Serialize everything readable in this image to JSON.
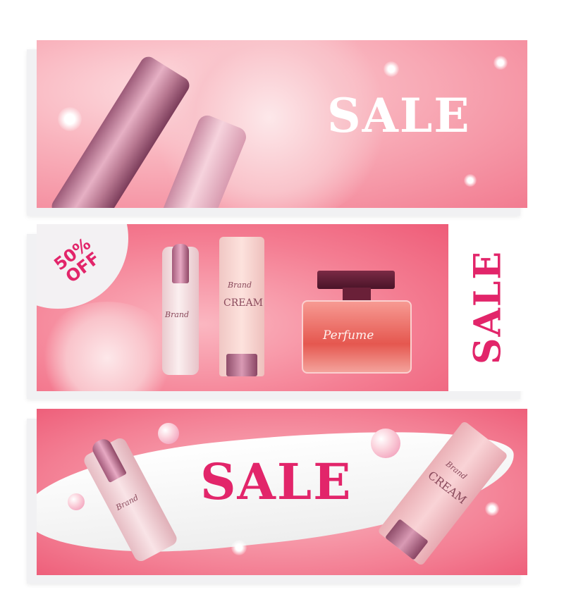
{
  "banner1": {
    "headline": "SALE"
  },
  "banner2": {
    "badge": "50% OFF",
    "headline": "SALE",
    "serum_label": "Brand",
    "tube_brand": "Brand",
    "tube_label": "CREAM",
    "perfume_label": "Perfume"
  },
  "banner3": {
    "headline": "SALE",
    "serum_label": "Brand",
    "tube_brand": "Brand",
    "tube_label": "CREAM"
  },
  "colors": {
    "accent": "#e2256a",
    "pink": "#f47d92",
    "white": "#ffffff"
  }
}
